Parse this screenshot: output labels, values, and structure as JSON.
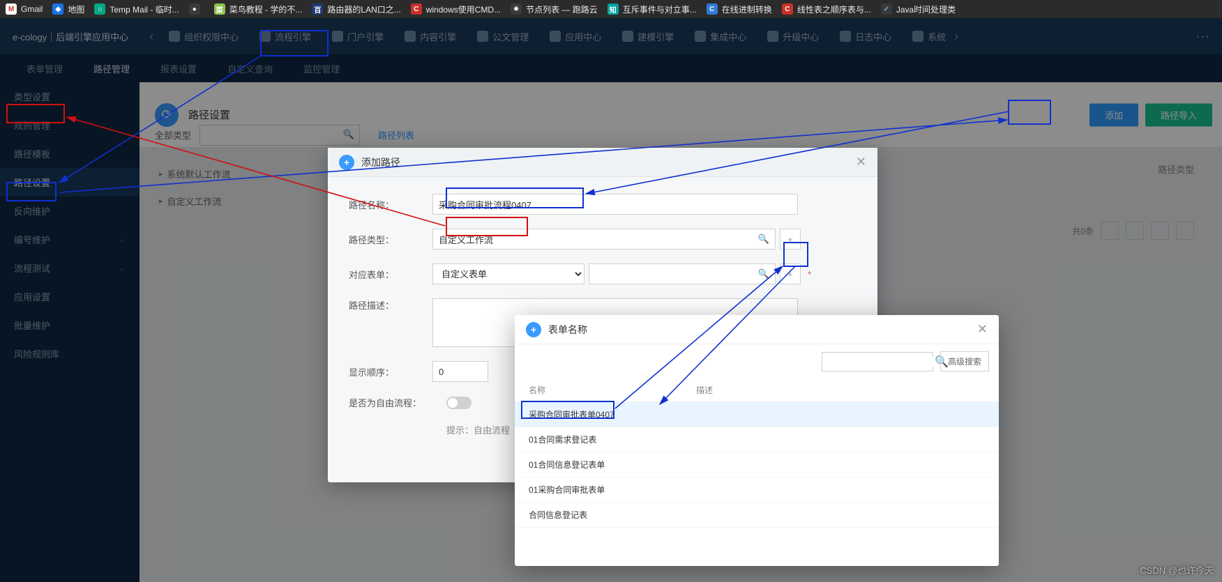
{
  "bookmarks": [
    {
      "label": "Gmail",
      "icon_bg": "#fff",
      "icon_fg": "#d93025",
      "glyph": "M"
    },
    {
      "label": "地图",
      "icon_bg": "#1a73e8",
      "icon_fg": "#fff",
      "glyph": "◆"
    },
    {
      "label": "Temp Mail - 临时...",
      "icon_bg": "#00a884",
      "icon_fg": "#fff",
      "glyph": "⌂"
    },
    {
      "label": "",
      "icon_bg": "#3a3a3a",
      "icon_fg": "#fff",
      "glyph": "●"
    },
    {
      "label": "菜鸟教程 - 学的不...",
      "icon_bg": "#8bc34a",
      "icon_fg": "#fff",
      "glyph": "菜"
    },
    {
      "label": "路由器的LAN口之...",
      "icon_bg": "#1f3b73",
      "icon_fg": "#fff",
      "glyph": "百"
    },
    {
      "label": "windows使用CMD...",
      "icon_bg": "#c9302c",
      "icon_fg": "#fff",
      "glyph": "C"
    },
    {
      "label": "节点列表 — 跑路云",
      "icon_bg": "#3a3a3a",
      "icon_fg": "#fff",
      "glyph": "✷"
    },
    {
      "label": "互斥事件与对立事...",
      "icon_bg": "#00a3a3",
      "icon_fg": "#fff",
      "glyph": "知"
    },
    {
      "label": "在线进制转换",
      "icon_bg": "#2e7bd6",
      "icon_fg": "#fff",
      "glyph": "C"
    },
    {
      "label": "线性表之顺序表与...",
      "icon_bg": "#c9302c",
      "icon_fg": "#fff",
      "glyph": "C"
    },
    {
      "label": "Java时间处理类",
      "icon_bg": "#3a3a3a",
      "icon_fg": "#6fb5ff",
      "glyph": "✓"
    }
  ],
  "brand": "e-cology｜后端引擎应用中心",
  "header_menu": [
    "组织权限中心",
    "流程引擎",
    "门户引擎",
    "内容引擎",
    "公文管理",
    "应用中心",
    "建模引擎",
    "集成中心",
    "升级中心",
    "日志中心",
    "系统"
  ],
  "sub_tabs": [
    "表单管理",
    "路径管理",
    "报表设置",
    "自定义查询",
    "监控管理"
  ],
  "sub_tab_active": 1,
  "sidebar": [
    {
      "label": "类型设置"
    },
    {
      "label": "规则管理"
    },
    {
      "label": "路径模板"
    },
    {
      "label": "路径设置",
      "active": true
    },
    {
      "label": "反向维护"
    },
    {
      "label": "编号维护",
      "chev": true
    },
    {
      "label": "流程测试",
      "chev": true
    },
    {
      "label": "应用设置"
    },
    {
      "label": "批量维护"
    },
    {
      "label": "风险规则库"
    }
  ],
  "page": {
    "title": "路径设置",
    "btn_add": "添加",
    "btn_import": "路径导入",
    "filter_label": "全部类型",
    "filter_tab": "路径列表",
    "tree": [
      "系统默认工作流",
      "自定义工作流"
    ],
    "col_right": "路径类型",
    "total": "共0条"
  },
  "modal1": {
    "title": "添加路径",
    "rows": {
      "name_label": "路径名称：",
      "name_value": "采购合同审批流程0407",
      "type_label": "路径类型：",
      "type_value": "自定义工作流",
      "form_label": "对应表单：",
      "form_select": "自定义表单",
      "desc_label": "路径描述：",
      "order_label": "显示顺序：",
      "order_value": "0",
      "free_label": "是否为自由流程：",
      "hint": "提示：自由流程"
    }
  },
  "modal2": {
    "title": "表单名称",
    "adv_search": "高级搜索",
    "col_name": "名称",
    "col_desc": "描述",
    "rows": [
      "采购合同审批表单0407",
      "01合同需求登记表",
      "01合同信息登记表单",
      "01采购合同审批表单",
      "合同信息登记表"
    ]
  },
  "watermark": "CSDN @也许今天"
}
